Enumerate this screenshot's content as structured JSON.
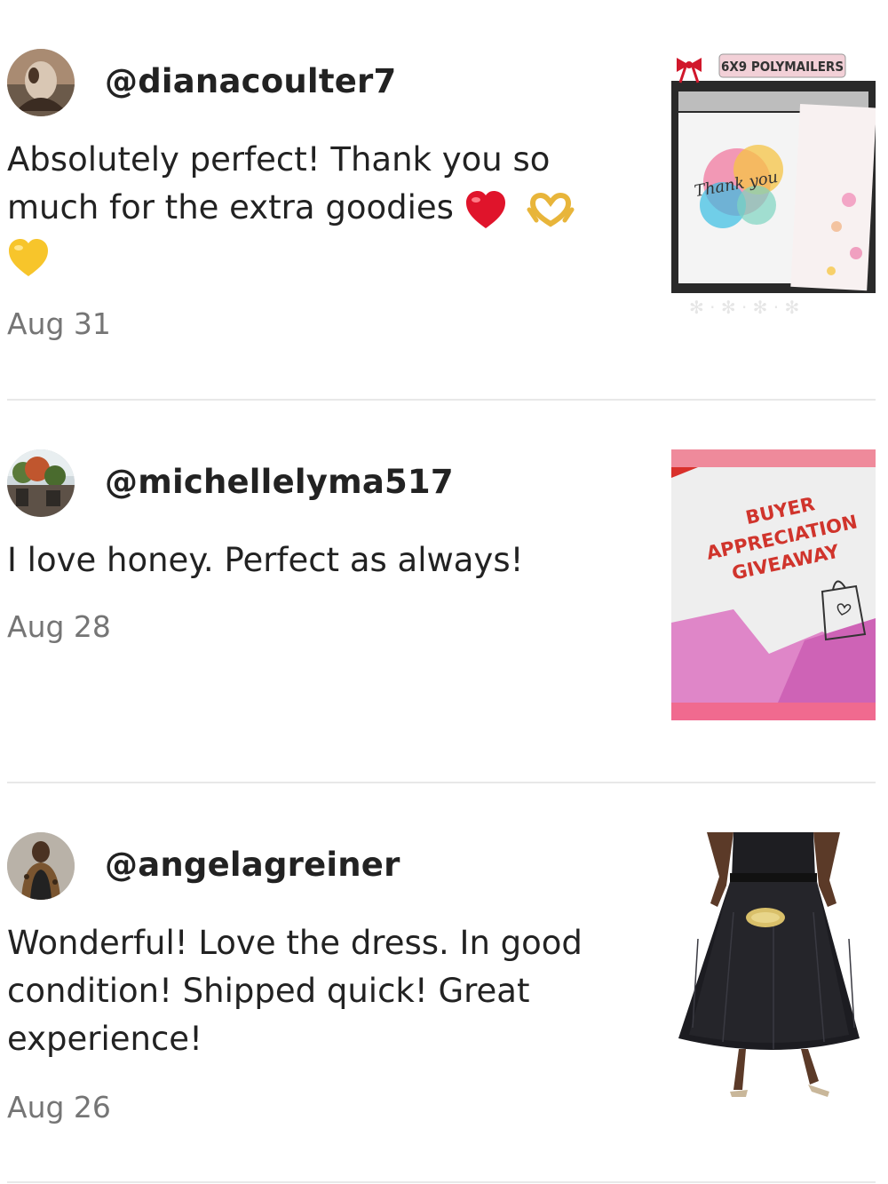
{
  "reviews": [
    {
      "username": "@dianacoulter7",
      "comment": "Absolutely perfect! Thank you so much for the extra goodies",
      "emojis": [
        "red-heart",
        "heart-hands",
        "yellow-heart"
      ],
      "date": "Aug 31",
      "thumb": {
        "banner": "6X9 POLYMAILERS",
        "script": "Thank you"
      }
    },
    {
      "username": "@michellelyma517",
      "comment": "I love honey. Perfect as always!",
      "date": "Aug 28",
      "thumb": {
        "line1": "BUYER",
        "line2": "APPRECIATION",
        "line3": "GIVEAWAY"
      }
    },
    {
      "username": "@angelagreiner",
      "comment": "Wonderful! Love the dress. In good condition! Shipped quick! Great experience!",
      "date": "Aug 26"
    }
  ],
  "colors": {
    "text": "#222222",
    "muted": "#757575",
    "divider": "#e8e8e8"
  }
}
